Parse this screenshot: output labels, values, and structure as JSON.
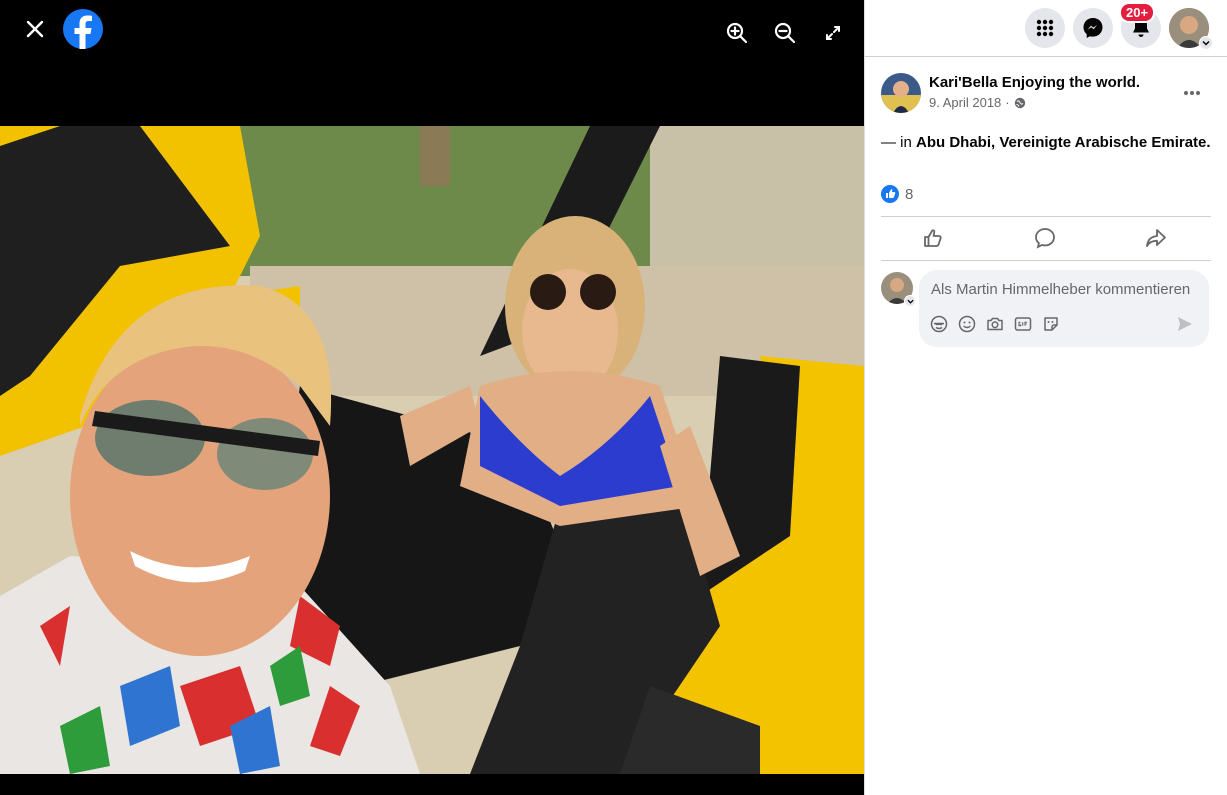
{
  "viewer": {
    "icons": [
      "close-icon",
      "facebook-logo",
      "zoom-in-icon",
      "zoom-out-icon",
      "fullscreen-icon"
    ]
  },
  "header": {
    "notifications_badge": "20+",
    "icons": [
      "menu-grid-icon",
      "messenger-icon",
      "bell-icon",
      "account-avatar"
    ]
  },
  "post": {
    "author": "Kari'Bella Enjoying the world.",
    "date": "9. April 2018",
    "date_separator": "·",
    "location_prefix": "— in ",
    "location": "Abu Dhabi, Vereinigte Arabische Emirate.",
    "like_count": "8"
  },
  "comment": {
    "placeholder": "Als Martin Himmelheber kommentieren"
  },
  "colors": {
    "brand": "#1877f2",
    "badge": "#e41e3f",
    "muted": "#65676b"
  }
}
